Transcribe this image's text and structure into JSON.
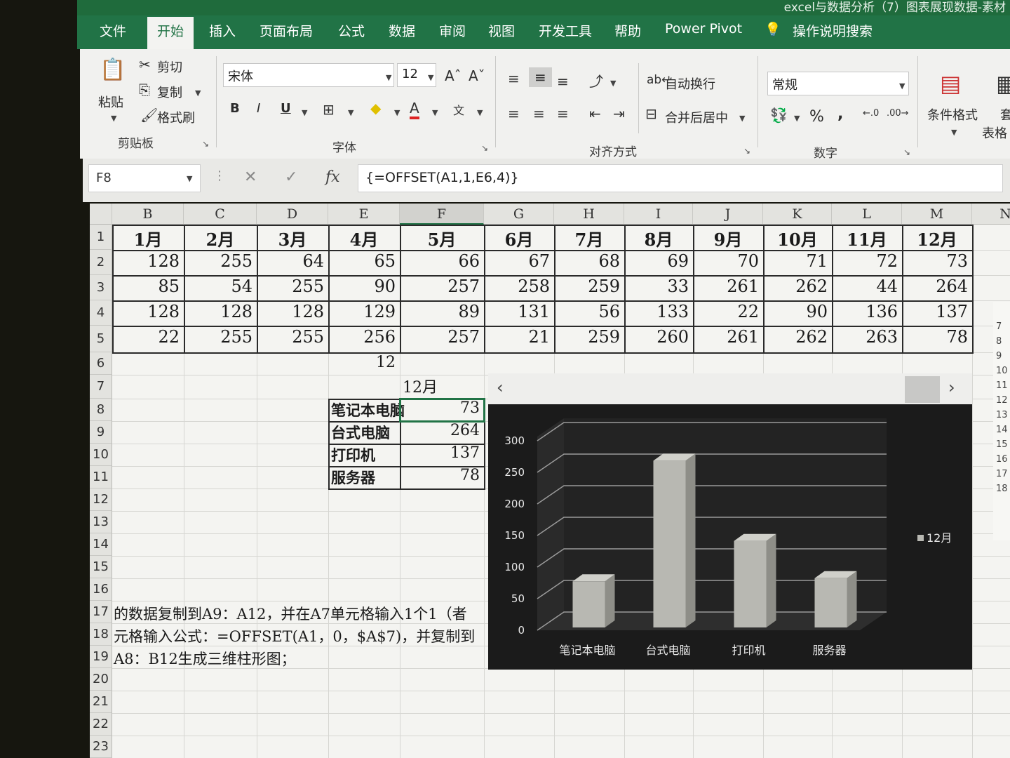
{
  "title_bar": {
    "text": "excel与数据分析（7）图表展现数据-素材"
  },
  "tabs": [
    "文件",
    "开始",
    "插入",
    "页面布局",
    "公式",
    "数据",
    "审阅",
    "视图",
    "开发工具",
    "帮助",
    "Power Pivot",
    "操作说明搜索"
  ],
  "active_tab": "开始",
  "ribbon": {
    "clipboard": {
      "paste": "粘贴",
      "cut": "剪切",
      "copy": "复制",
      "format_painter": "格式刷",
      "group": "剪贴板"
    },
    "font": {
      "name": "宋体",
      "size": "12",
      "bold": "B",
      "italic": "I",
      "underline": "U",
      "group": "字体"
    },
    "alignment": {
      "wrap": "自动换行",
      "merge": "合并后居中",
      "group": "对齐方式"
    },
    "number": {
      "format": "常规",
      "percent": "%",
      "comma": ",",
      "group": "数字"
    },
    "styles": {
      "conditional": "条件格式",
      "table_partial": "套",
      "table_partial2": "表格"
    }
  },
  "formula_bar": {
    "name_box": "F8",
    "formula": "{=OFFSET(A1,1,E6,4)}"
  },
  "columns": [
    "B",
    "C",
    "D",
    "E",
    "F",
    "G",
    "H",
    "I",
    "J",
    "K",
    "L",
    "M",
    "N"
  ],
  "rows": [
    "1",
    "2",
    "3",
    "4",
    "5",
    "6",
    "7",
    "8",
    "9",
    "10",
    "11",
    "12",
    "13",
    "14",
    "15",
    "16",
    "17",
    "18",
    "19",
    "20",
    "21",
    "22",
    "23"
  ],
  "table": {
    "headers": [
      "1月",
      "2月",
      "3月",
      "4月",
      "5月",
      "6月",
      "7月",
      "8月",
      "9月",
      "10月",
      "11月",
      "12月"
    ],
    "data": [
      [
        "128",
        "255",
        "64",
        "65",
        "66",
        "67",
        "68",
        "69",
        "70",
        "71",
        "72",
        "73"
      ],
      [
        "85",
        "54",
        "255",
        "90",
        "257",
        "258",
        "259",
        "33",
        "261",
        "262",
        "44",
        "264"
      ],
      [
        "128",
        "128",
        "128",
        "129",
        "89",
        "131",
        "56",
        "133",
        "22",
        "90",
        "136",
        "137"
      ],
      [
        "22",
        "255",
        "255",
        "256",
        "257",
        "21",
        "259",
        "260",
        "261",
        "262",
        "263",
        "78"
      ]
    ]
  },
  "e6_value": "12",
  "f7_value": "12月",
  "lookup": {
    "labels": [
      "笔记本电脑",
      "台式电脑",
      "打印机",
      "服务器"
    ],
    "values": [
      "73",
      "264",
      "137",
      "78"
    ]
  },
  "notes": [
    "的数据复制到A9：A12，并在A7单元格输入1个1（者",
    "元格输入公式：=OFFSET(A1，0，$A$7)，并复制到",
    "A8：B12生成三维柱形图；"
  ],
  "right_row_numbers": [
    "7",
    "8",
    "9",
    "10",
    "11",
    "12",
    "13",
    "14",
    "15",
    "16",
    "17",
    "18"
  ],
  "chart_data": {
    "type": "bar",
    "categories": [
      "笔记本电脑",
      "台式电脑",
      "打印机",
      "服务器"
    ],
    "series": [
      {
        "name": "12月",
        "values": [
          73,
          264,
          137,
          78
        ]
      }
    ],
    "y_ticks": [
      "0",
      "50",
      "100",
      "150",
      "200",
      "250",
      "300"
    ],
    "ylim": [
      0,
      300
    ],
    "legend": "right",
    "style": "3d-column",
    "bar_color": "#b8b8b2",
    "background": "#1b1b1b",
    "grid": true
  }
}
